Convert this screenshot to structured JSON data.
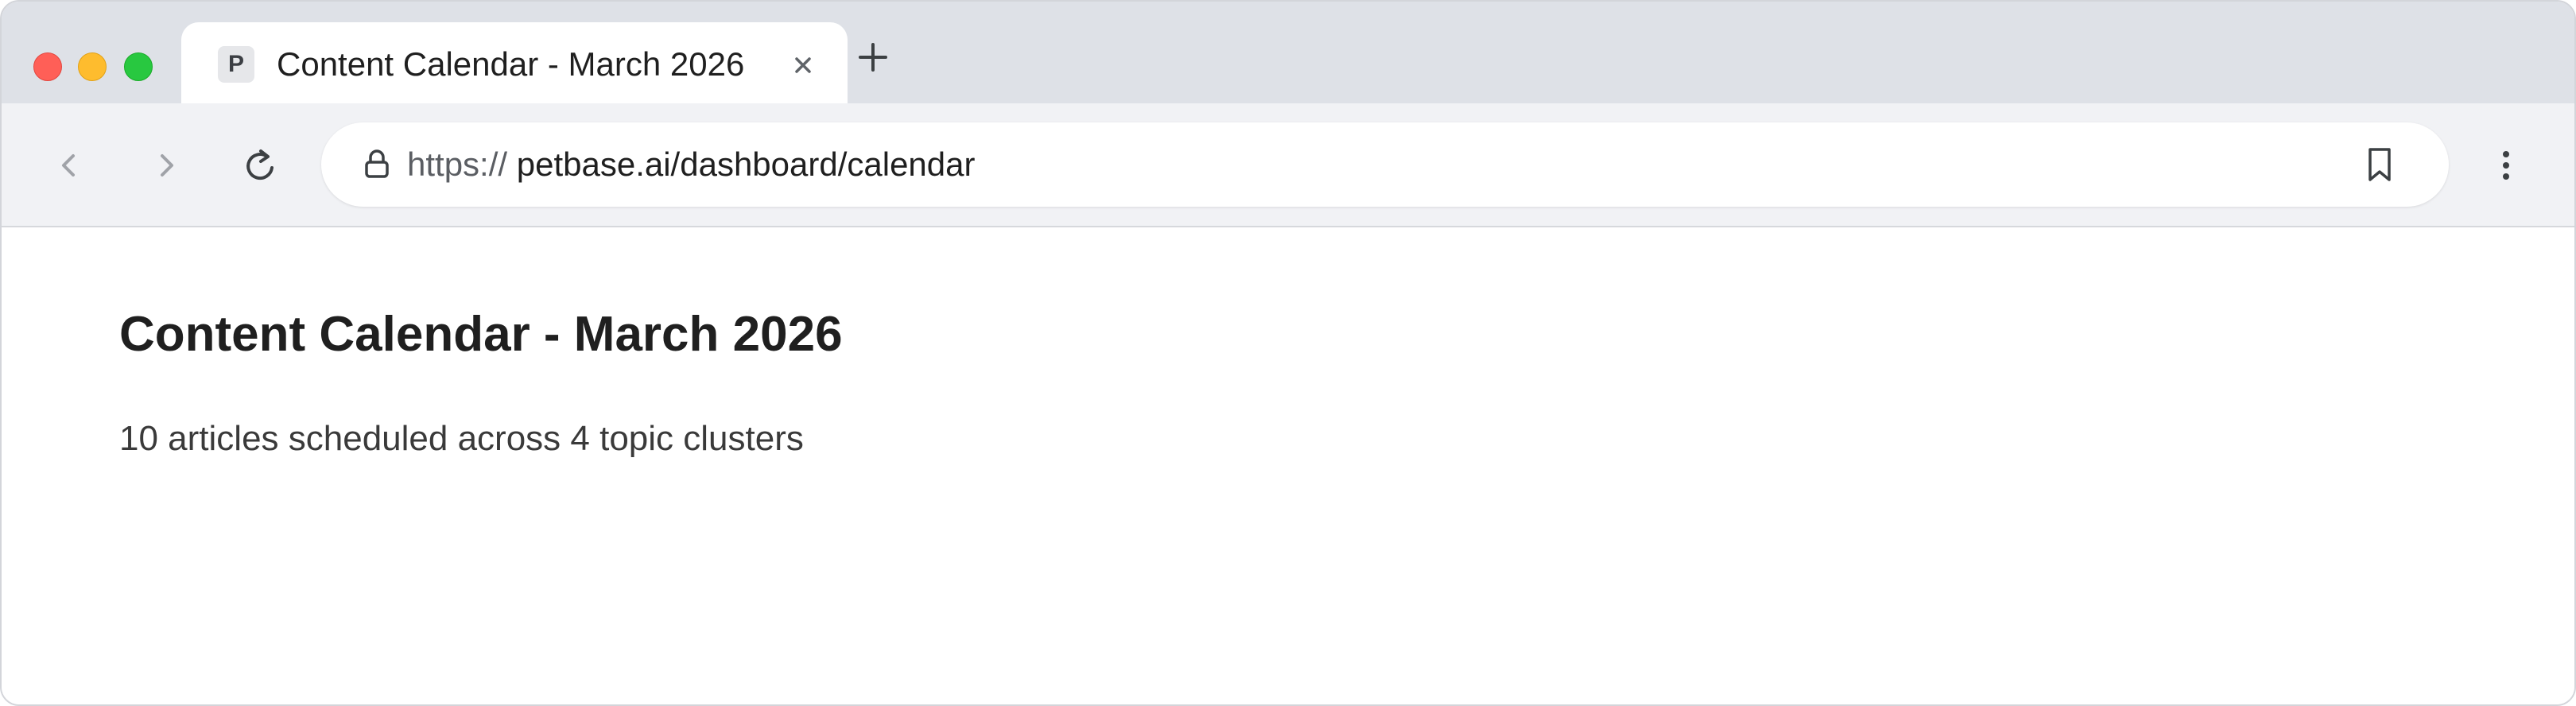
{
  "browser": {
    "tab": {
      "favicon_letter": "P",
      "title": "Content Calendar - March 2026",
      "close_icon": "close-icon"
    },
    "new_tab_icon": "plus-icon",
    "address_bar": {
      "scheme": "https://",
      "host_path": "petbase.ai/dashboard/calendar"
    },
    "icons": [
      "back-icon",
      "forward-icon",
      "reload-icon",
      "lock-icon",
      "bookmark-icon",
      "kebab-menu-icon"
    ],
    "colors": {
      "close": "#ff5f57",
      "minimize": "#febc2e",
      "maximize": "#28c840",
      "tabstrip": "#dee1e7",
      "toolbar": "#f1f2f5"
    }
  },
  "page": {
    "title": "Content Calendar - March 2026",
    "subtitle": "10 articles scheduled across 4 topic clusters"
  }
}
